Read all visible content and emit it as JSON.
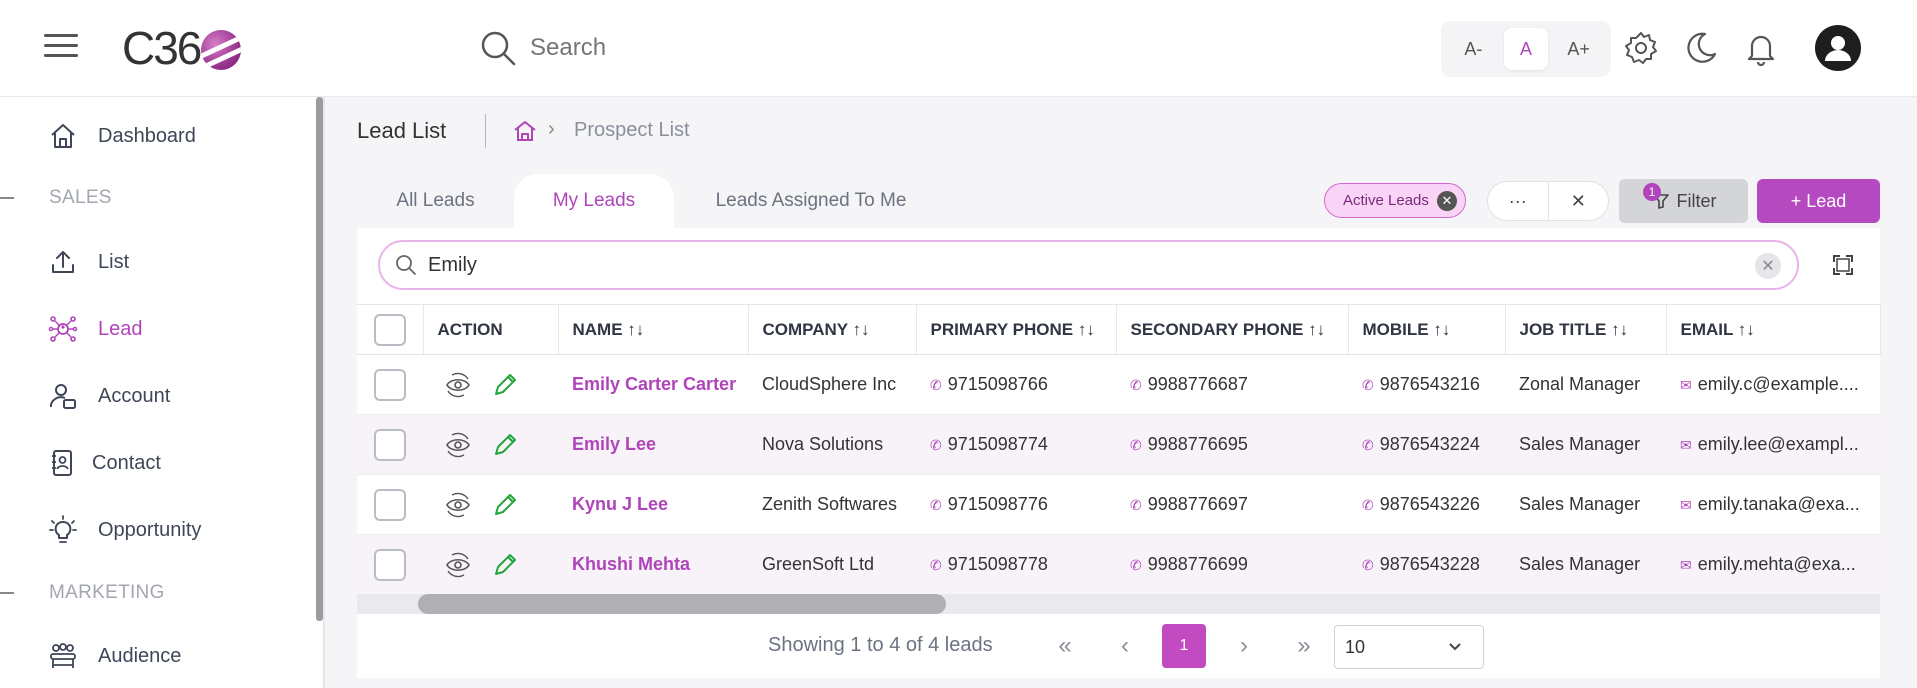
{
  "header": {
    "logo_text": "C36",
    "search_placeholder": "Search",
    "font_small": "A-",
    "font_normal": "A",
    "font_large": "A+"
  },
  "sidebar": {
    "items": [
      {
        "label": "Dashboard",
        "icon": "home-icon"
      },
      {
        "label": "List",
        "icon": "upload-icon"
      },
      {
        "label": "Lead",
        "icon": "lead-network-icon"
      },
      {
        "label": "Account",
        "icon": "account-icon"
      },
      {
        "label": "Contact",
        "icon": "contact-icon"
      },
      {
        "label": "Opportunity",
        "icon": "lightbulb-icon"
      },
      {
        "label": "Audience",
        "icon": "audience-icon"
      }
    ],
    "sections": {
      "sales": "SALES",
      "marketing": "MARKETING"
    },
    "active_item": "Lead"
  },
  "page": {
    "title": "Lead List",
    "breadcrumb_current": "Prospect List"
  },
  "tabs": [
    {
      "label": "All Leads",
      "active": false
    },
    {
      "label": "My Leads",
      "active": true
    },
    {
      "label": "Leads Assigned To Me",
      "active": false
    }
  ],
  "toolbar": {
    "chip_label": "Active Leads",
    "more_label": "···",
    "clear_label": "✕",
    "filter_label": "Filter",
    "filter_count": "1",
    "add_lead_label": "+ Lead"
  },
  "table_search": {
    "value": "Emily"
  },
  "table": {
    "columns": [
      "ACTION",
      "NAME ↑↓",
      "COMPANY ↑↓",
      "PRIMARY PHONE ↑↓",
      "SECONDARY PHONE ↑↓",
      "MOBILE ↑↓",
      "JOB TITLE ↑↓",
      "EMAIL ↑↓"
    ],
    "rows": [
      {
        "name": "Emily Carter Carter",
        "company": "CloudSphere Inc",
        "primary": "9715098766",
        "secondary": "9988776687",
        "mobile": "9876543216",
        "job": "Zonal Manager",
        "email": "emily.c@example...."
      },
      {
        "name": "Emily Lee",
        "company": "Nova Solutions",
        "primary": "9715098774",
        "secondary": "9988776695",
        "mobile": "9876543224",
        "job": "Sales Manager",
        "email": "emily.lee@exampl..."
      },
      {
        "name": "Kynu J Lee",
        "company": "Zenith Softwares",
        "primary": "9715098776",
        "secondary": "9988776697",
        "mobile": "9876543226",
        "job": "Sales Manager",
        "email": "emily.tanaka@exa..."
      },
      {
        "name": "Khushi Mehta",
        "company": "GreenSoft Ltd",
        "primary": "9715098778",
        "secondary": "9988776699",
        "mobile": "9876543228",
        "job": "Sales Manager",
        "email": "emily.mehta@exa..."
      }
    ]
  },
  "pagination": {
    "summary": "Showing 1 to 4 of 4 leads",
    "first": "«",
    "prev": "‹",
    "current_page": "1",
    "next": "›",
    "last": "»",
    "rows_per_page": "10"
  },
  "colors": {
    "accent": "#b044ba",
    "chip_bg": "#f9d4f6"
  }
}
